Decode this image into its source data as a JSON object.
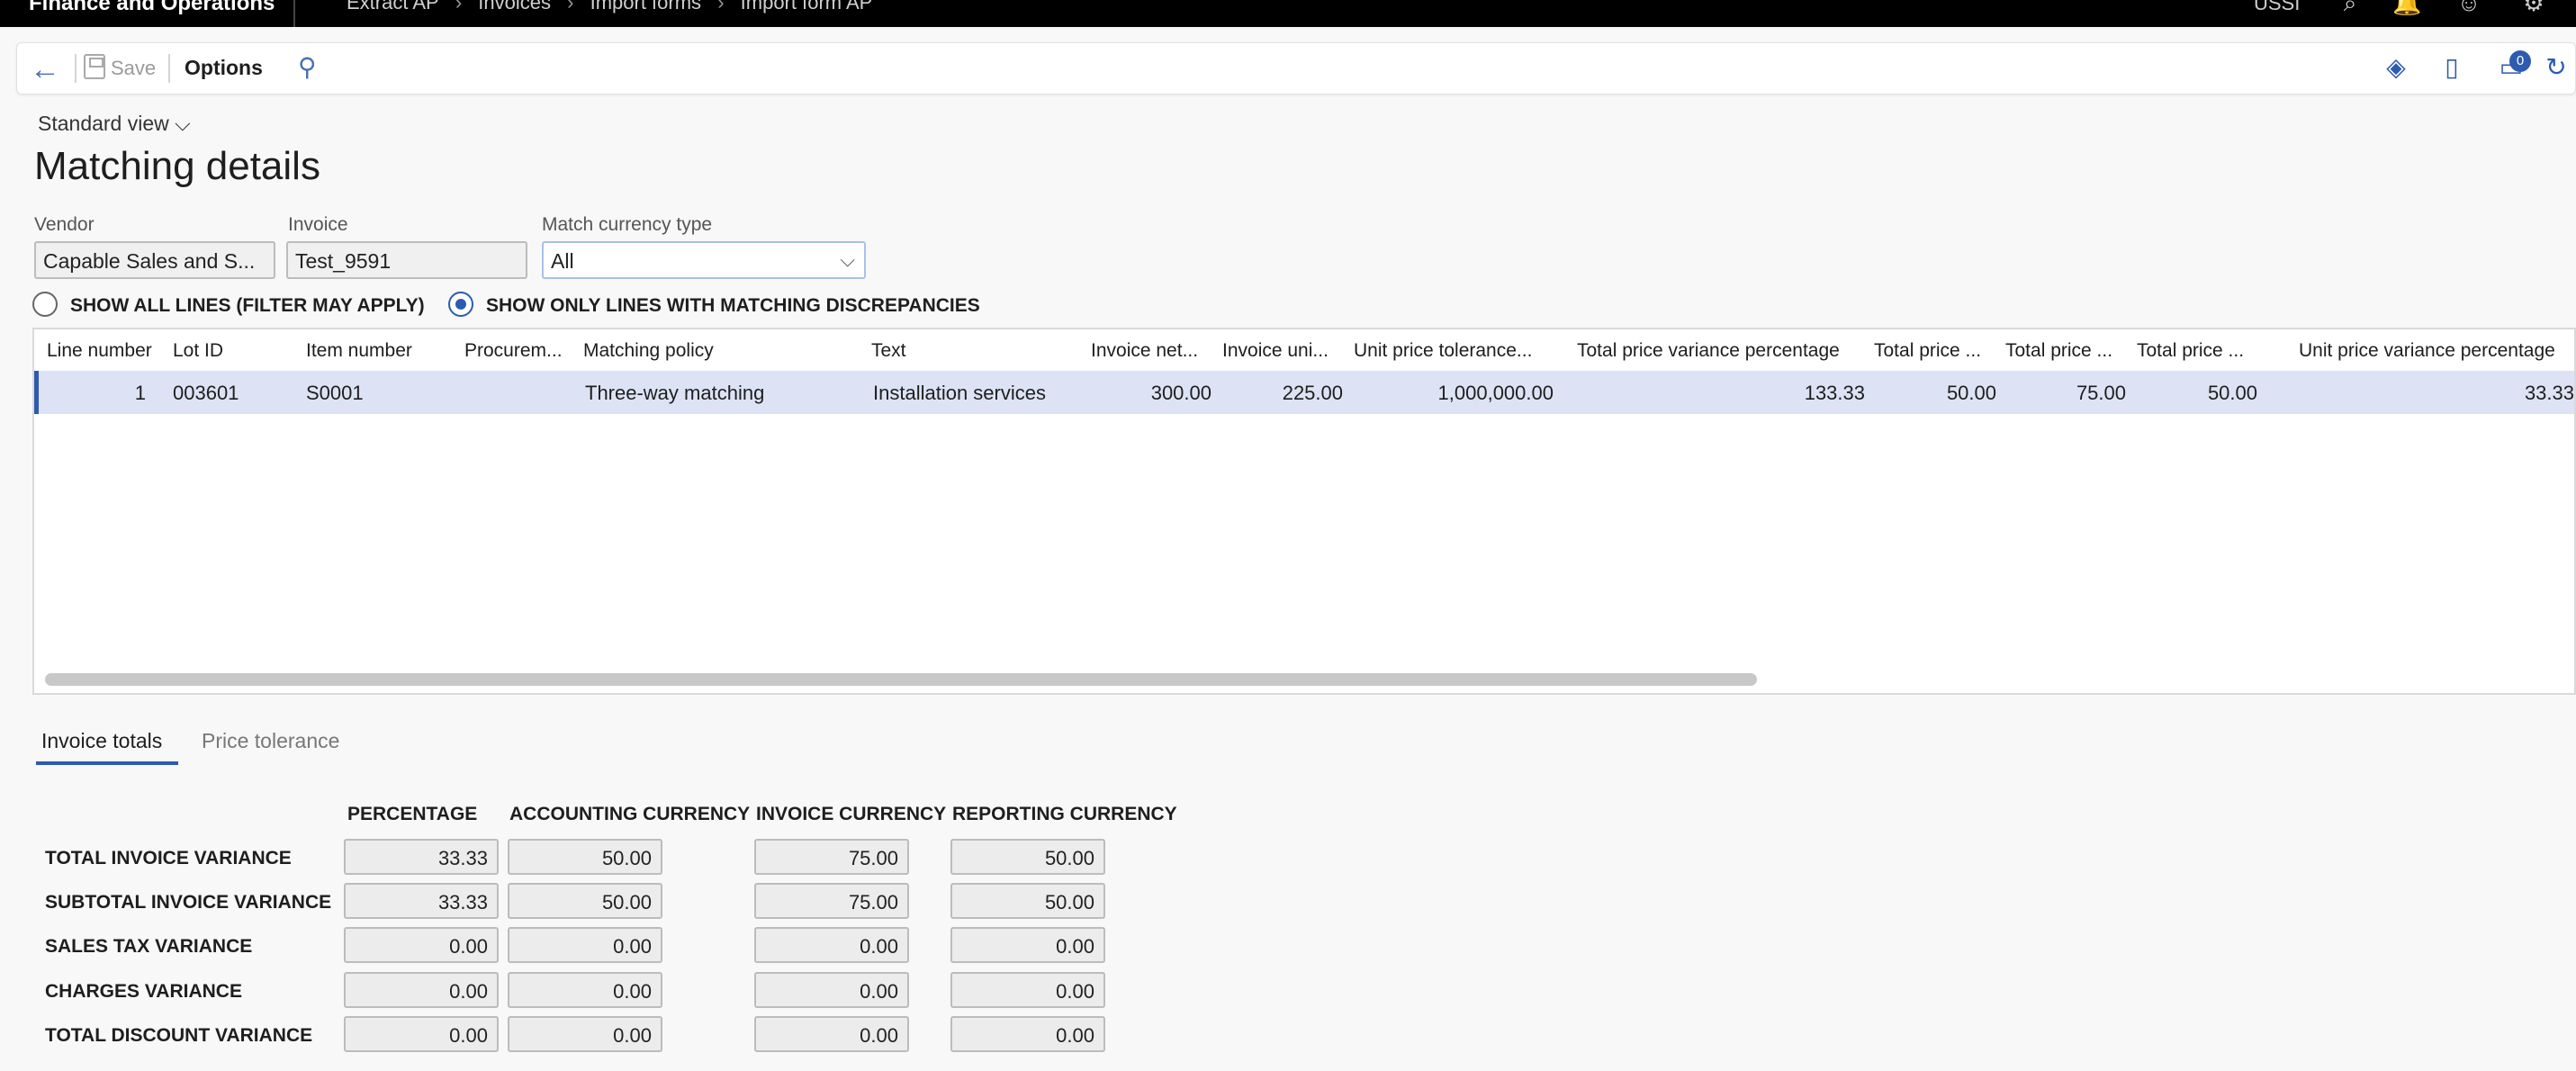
{
  "topbar": {
    "app_name": "Finance and Operations",
    "breadcrumbs": [
      "Extract AP",
      "Invoices",
      "Import forms",
      "Import form AP"
    ],
    "company": "USSI"
  },
  "actionbar": {
    "save_label": "Save",
    "options_label": "Options",
    "notification_count": "0"
  },
  "header": {
    "view_selector": "Standard view",
    "title": "Matching details"
  },
  "fields": {
    "vendor_label": "Vendor",
    "vendor_value": "Capable Sales and S...",
    "invoice_label": "Invoice",
    "invoice_value": "Test_9591",
    "currency_label": "Match currency type",
    "currency_value": "All"
  },
  "filters": {
    "show_all": "SHOW ALL LINES (FILTER MAY APPLY)",
    "show_discrepancies": "SHOW ONLY LINES WITH MATCHING DISCREPANCIES",
    "selected": "show_discrepancies"
  },
  "grid": {
    "columns": [
      "Line number",
      "Lot ID",
      "Item number",
      "Procurem...",
      "Matching policy",
      "Text",
      "Invoice net...",
      "Invoice uni...",
      "Unit price tolerance...",
      "Total price variance percentage",
      "Total price ...",
      "Total price ...",
      "Total price ...",
      "Unit price variance percentage"
    ],
    "rows": [
      {
        "line_number": "1",
        "lot_id": "003601",
        "item_number": "S0001",
        "procurement": "",
        "matching_policy": "Three-way matching",
        "text": "Installation services",
        "invoice_net": "300.00",
        "invoice_unit": "225.00",
        "unit_price_tolerance": "1,000,000.00",
        "total_price_variance_pct": "133.33",
        "total_price_1": "50.00",
        "total_price_2": "75.00",
        "total_price_3": "50.00",
        "unit_price_variance_pct": "33.33"
      }
    ]
  },
  "tabs": [
    "Invoice totals",
    "Price tolerance"
  ],
  "totals": {
    "columns": [
      "PERCENTAGE",
      "ACCOUNTING CURRENCY",
      "INVOICE CURRENCY",
      "REPORTING CURRENCY"
    ],
    "rows": [
      {
        "label": "TOTAL INVOICE VARIANCE",
        "values": [
          "33.33",
          "50.00",
          "75.00",
          "50.00"
        ]
      },
      {
        "label": "SUBTOTAL INVOICE VARIANCE",
        "values": [
          "33.33",
          "50.00",
          "75.00",
          "50.00"
        ]
      },
      {
        "label": "SALES TAX VARIANCE",
        "values": [
          "0.00",
          "0.00",
          "0.00",
          "0.00"
        ]
      },
      {
        "label": "CHARGES VARIANCE",
        "values": [
          "0.00",
          "0.00",
          "0.00",
          "0.00"
        ]
      },
      {
        "label": "TOTAL DISCOUNT VARIANCE",
        "values": [
          "0.00",
          "0.00",
          "0.00",
          "0.00"
        ]
      }
    ]
  },
  "colors": {
    "accent": "#2d5bb0",
    "selected_row": "#dde3f4",
    "topbar": "#000000"
  }
}
